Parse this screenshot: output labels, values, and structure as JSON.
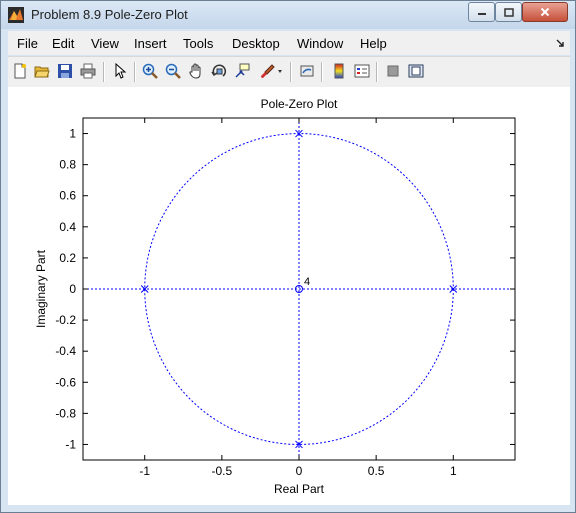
{
  "window": {
    "title": "Problem 8.9 Pole-Zero Plot",
    "icon": "matlab-figure-icon",
    "controls": [
      "minimize-icon",
      "maximize-icon",
      "close-icon"
    ]
  },
  "menu": {
    "items": [
      "File",
      "Edit",
      "View",
      "Insert",
      "Tools",
      "Desktop",
      "Window",
      "Help"
    ],
    "dock_icon": "dock-arrow-icon"
  },
  "toolbar": {
    "buttons": [
      "new-figure-icon",
      "open-file-icon",
      "save-icon",
      "print-icon",
      "edit-plot-arrow-icon",
      "zoom-in-icon",
      "zoom-out-icon",
      "pan-hand-icon",
      "rotate-3d-icon",
      "data-cursor-icon",
      "brush-icon",
      "link-plot-icon",
      "colorbar-icon",
      "legend-icon",
      "hide-plot-tools-icon",
      "show-plot-tools-icon"
    ]
  },
  "chart_data": {
    "type": "scatter",
    "title": "Pole-Zero Plot",
    "xlabel": "Real Part",
    "ylabel": "Imaginary Part",
    "xlim": [
      -1.4,
      1.4
    ],
    "ylim": [
      -1.1,
      1.1
    ],
    "xticks": [
      -1,
      -0.5,
      0,
      0.5,
      1
    ],
    "xtick_labels": [
      "-1",
      "-0.5",
      "0",
      "0.5",
      "1"
    ],
    "yticks": [
      -1,
      -0.8,
      -0.6,
      -0.4,
      -0.2,
      0,
      0.2,
      0.4,
      0.6,
      0.8,
      1
    ],
    "ytick_labels": [
      "-1",
      "-0.8",
      "-0.6",
      "-0.4",
      "-0.2",
      "0",
      "0.2",
      "0.4",
      "0.6",
      "0.8",
      "1"
    ],
    "unit_circle": true,
    "grid": false,
    "series": [
      {
        "name": "Poles",
        "marker": "x",
        "points": [
          [
            1,
            0
          ],
          [
            -1,
            0
          ],
          [
            0,
            1
          ],
          [
            0,
            -1
          ]
        ]
      },
      {
        "name": "Zeros",
        "marker": "o",
        "points": [
          [
            0,
            0
          ]
        ]
      }
    ],
    "annotations": [
      {
        "x": 0,
        "y": 0,
        "text": "4"
      }
    ],
    "color": "#0000ff"
  }
}
